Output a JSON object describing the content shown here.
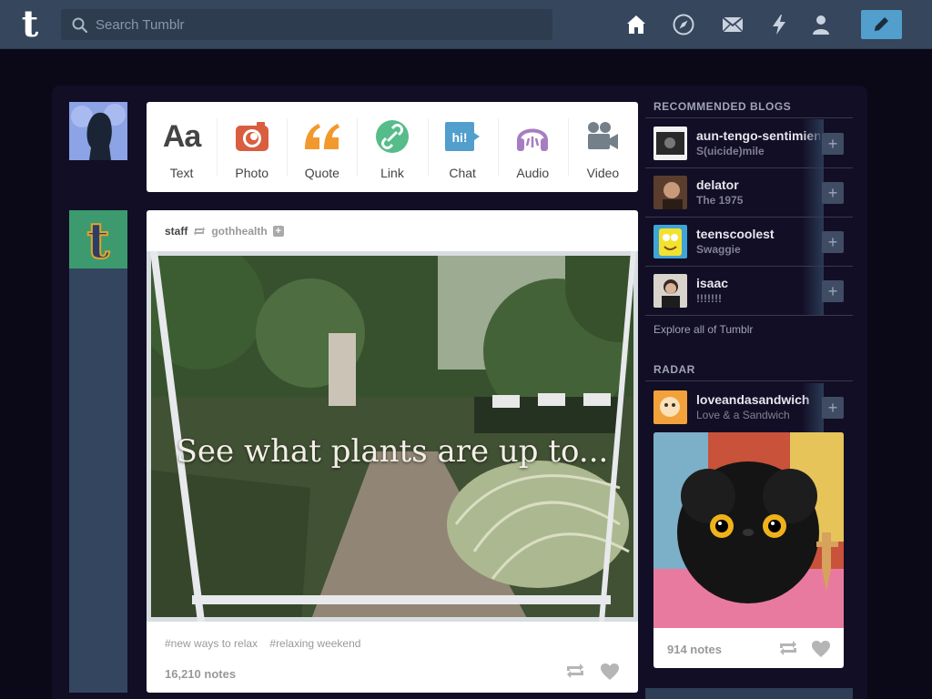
{
  "app": {
    "logo_letter": "t"
  },
  "search": {
    "placeholder": "Search Tumblr"
  },
  "nav": [
    "home-icon",
    "explore-icon",
    "inbox-icon",
    "activity-icon",
    "account-icon"
  ],
  "colors": {
    "topbar": "#36465d",
    "accent": "#529ecc",
    "background": "#0b0818"
  },
  "post_types": [
    {
      "label": "Text",
      "icon": "text-icon",
      "color": "#444444"
    },
    {
      "label": "Photo",
      "icon": "camera-icon",
      "color": "#d95e40"
    },
    {
      "label": "Quote",
      "icon": "quote-icon",
      "color": "#f2992e"
    },
    {
      "label": "Link",
      "icon": "link-icon",
      "color": "#56bc8a"
    },
    {
      "label": "Chat",
      "icon": "chat-icon",
      "color": "#529ecc"
    },
    {
      "label": "Audio",
      "icon": "headphones-icon",
      "color": "#a77dc2"
    },
    {
      "label": "Video",
      "icon": "video-camera-icon",
      "color": "#748089"
    }
  ],
  "post": {
    "author": "staff",
    "reblogged_from": "gothhealth",
    "image_caption": "See what plants are up to...",
    "tags": [
      "#new ways to relax",
      "#relaxing weekend"
    ],
    "notes": "16,210 notes"
  },
  "sidebar": {
    "recommended_title": "RECOMMENDED BLOGS",
    "blogs": [
      {
        "name": "aun-tengo-sentimientos",
        "title": "S(uicide)mile"
      },
      {
        "name": "delator",
        "title": "The 1975"
      },
      {
        "name": "teenscoolest",
        "title": "Swaggie"
      },
      {
        "name": "isaac",
        "title": "!!!!!!!"
      }
    ],
    "explore": "Explore all of Tumblr",
    "radar_title": "RADAR",
    "radar": {
      "name": "loveandasandwich",
      "title": "Love & a Sandwich",
      "notes": "914 notes"
    }
  }
}
